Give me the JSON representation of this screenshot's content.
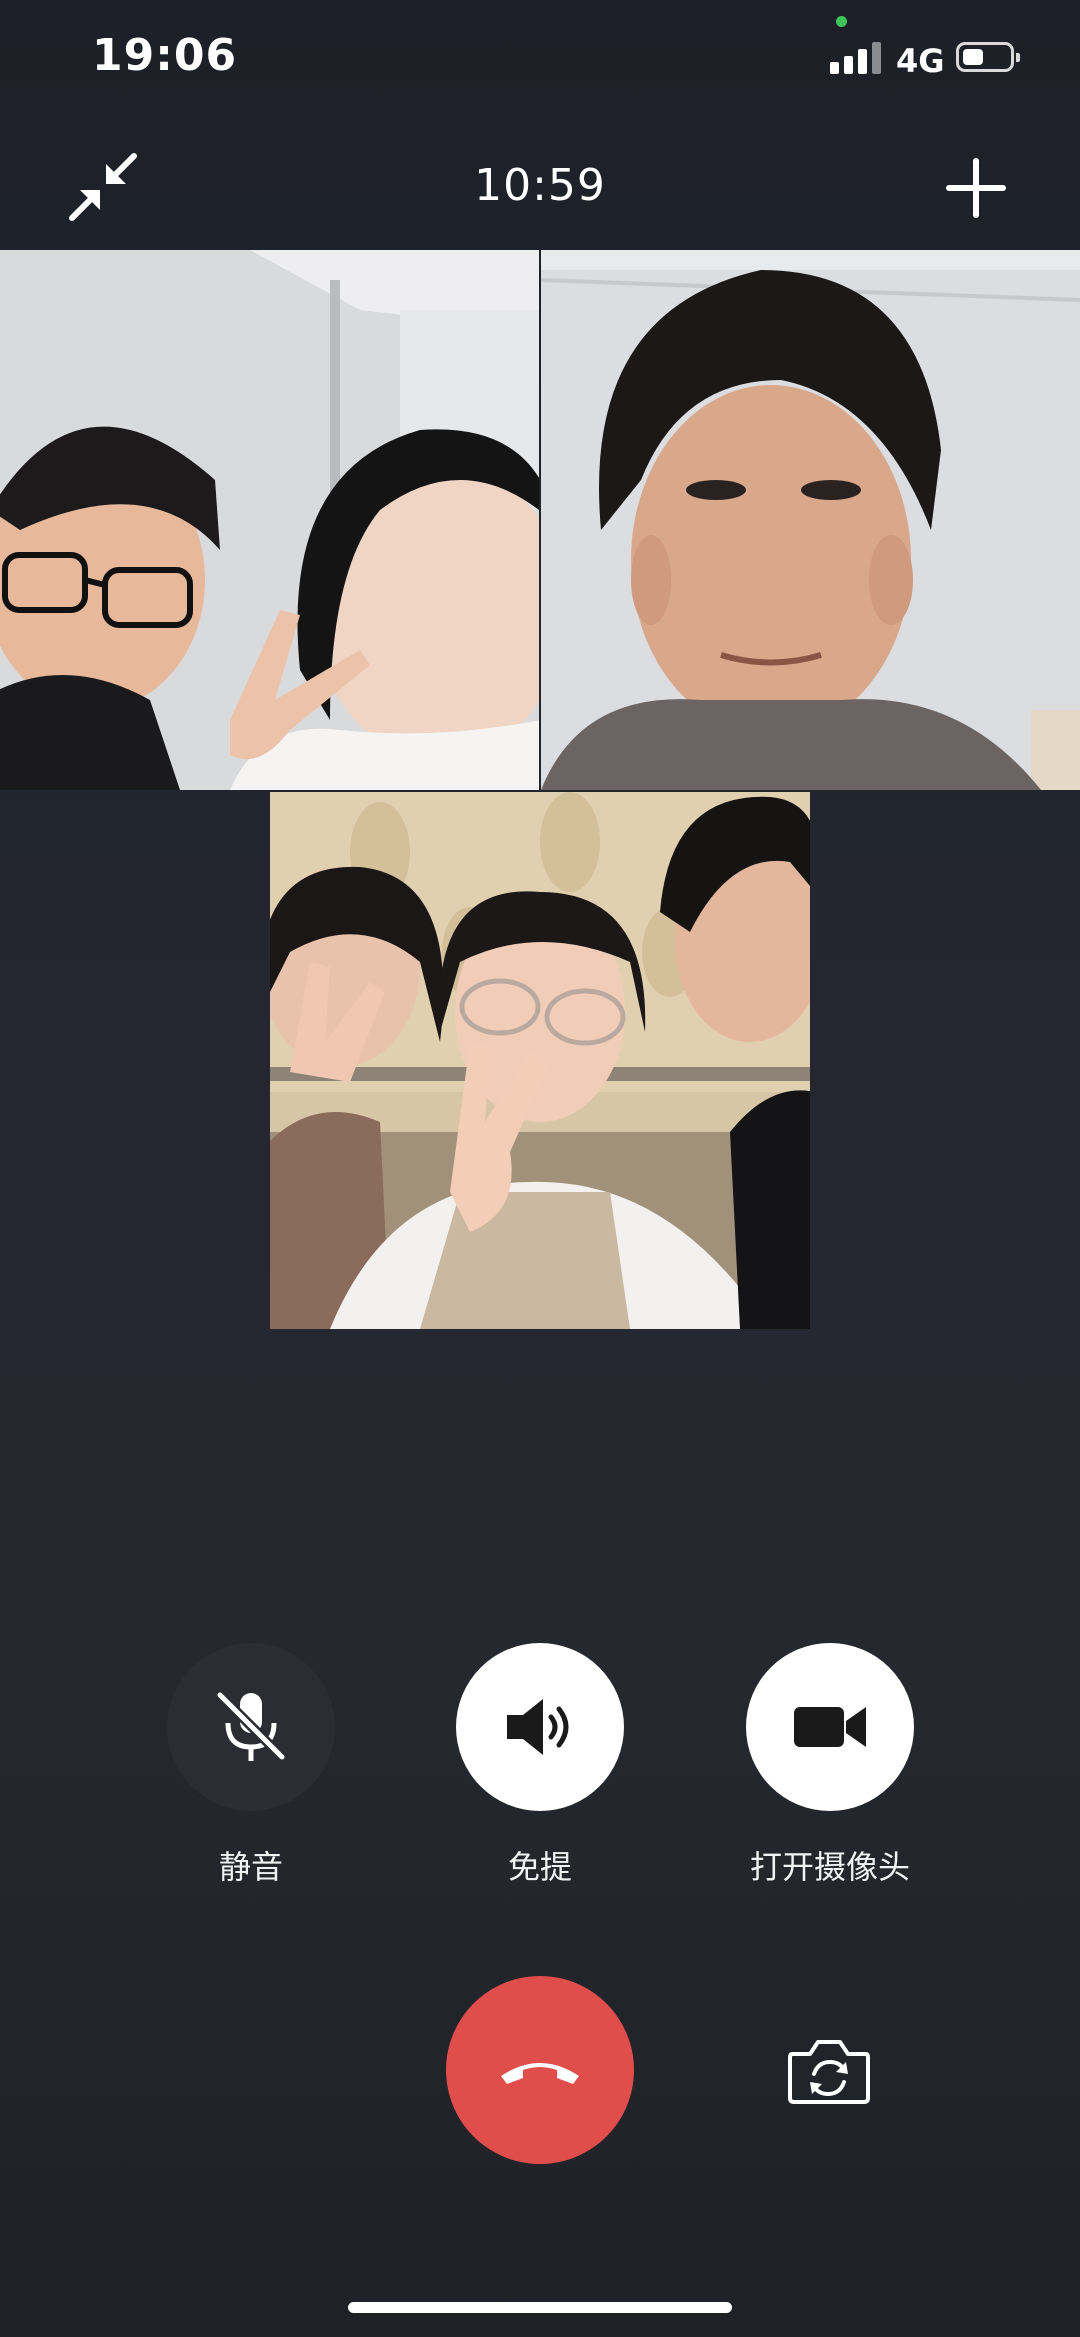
{
  "status_bar": {
    "time": "19:06",
    "network": "4G",
    "signal_bars": 3,
    "battery_level": 0.45,
    "privacy_dot_color": "#3ec55a"
  },
  "header": {
    "minimize_icon": "minimize-arrows-icon",
    "call_duration": "10:59",
    "add_icon": "plus-icon"
  },
  "video_tiles": [
    {
      "id": "participant-1",
      "description_icon": "video-feed"
    },
    {
      "id": "participant-2",
      "description_icon": "video-feed"
    },
    {
      "id": "participant-3",
      "description_icon": "video-feed"
    }
  ],
  "controls": {
    "mute": {
      "label": "静音",
      "icon": "mic-off-icon",
      "active": false
    },
    "speaker": {
      "label": "免提",
      "icon": "speaker-icon",
      "active": true
    },
    "camera": {
      "label": "打开摄像头",
      "icon": "video-camera-icon",
      "active": true
    }
  },
  "bottom": {
    "hangup_icon": "hang-up-phone-icon",
    "flip_icon": "flip-camera-icon"
  },
  "colors": {
    "background": "#22242b",
    "hangup": "#e04e4c",
    "control_active": "#ffffff",
    "control_inactive": "#2c2d33"
  }
}
